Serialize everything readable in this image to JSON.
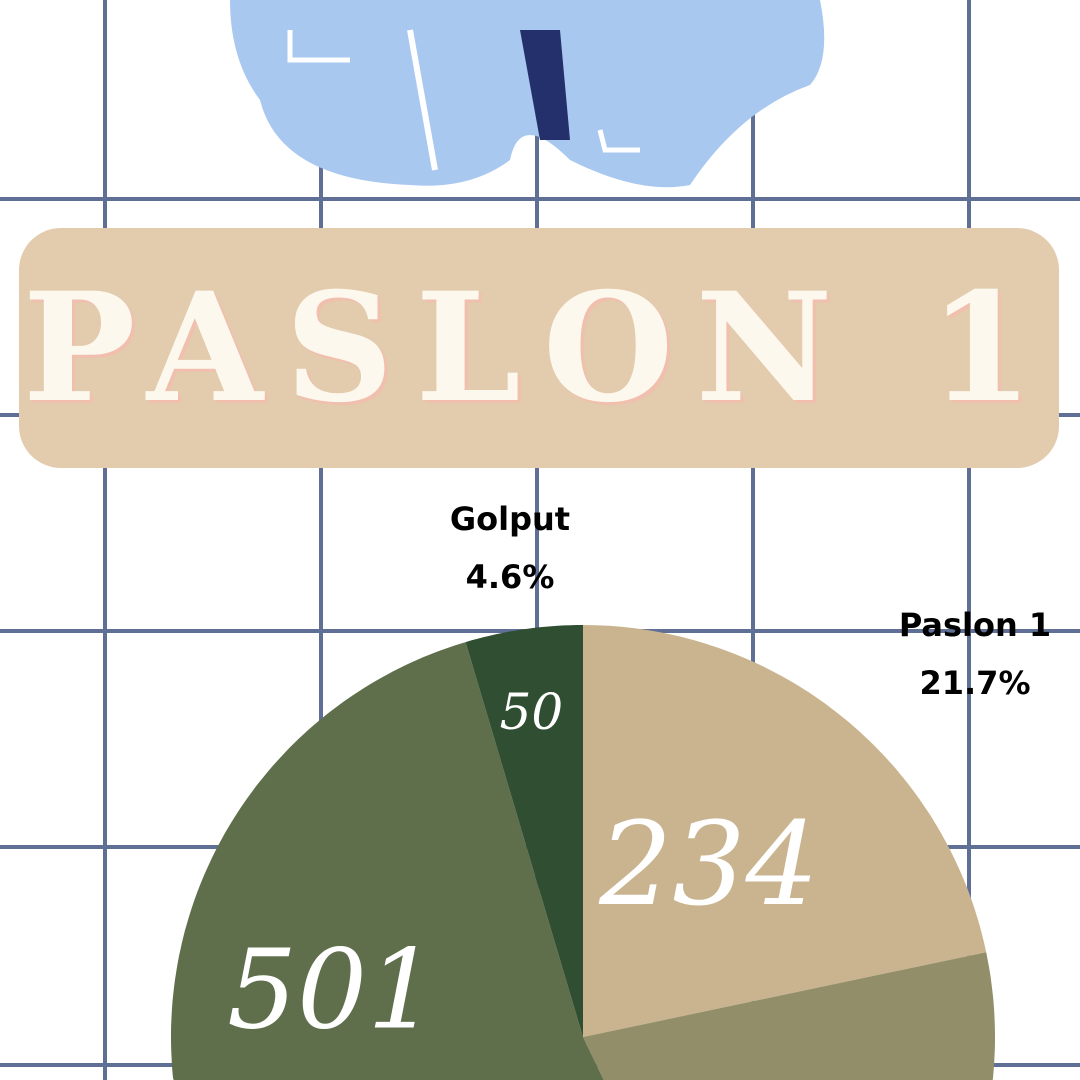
{
  "banner": {
    "title": "PASLON 1"
  },
  "colors": {
    "grid": "#5f6f96",
    "banner": "#e3cbad",
    "shirt": "#a9c8f0"
  },
  "chart_data": {
    "type": "pie",
    "title": "PASLON 1",
    "slices": [
      {
        "name": "Paslon 1",
        "percent": 21.7,
        "value": 234,
        "color": "#c9b48f",
        "label": "Paslon 1",
        "pct_label": "21.7%",
        "value_label": "234"
      },
      {
        "name": "",
        "percent": 27.5,
        "value": null,
        "color": "#928e69",
        "label": "",
        "pct_label": "",
        "value_label": ""
      },
      {
        "name": "",
        "percent": 46.2,
        "value": 501,
        "color": "#5f6f4c",
        "label": "",
        "pct_label": "",
        "value_label": "501"
      },
      {
        "name": "Golput",
        "percent": 4.6,
        "value": 50,
        "color": "#2f4e32",
        "label": "Golput",
        "pct_label": "4.6%",
        "value_label": "50"
      }
    ]
  }
}
